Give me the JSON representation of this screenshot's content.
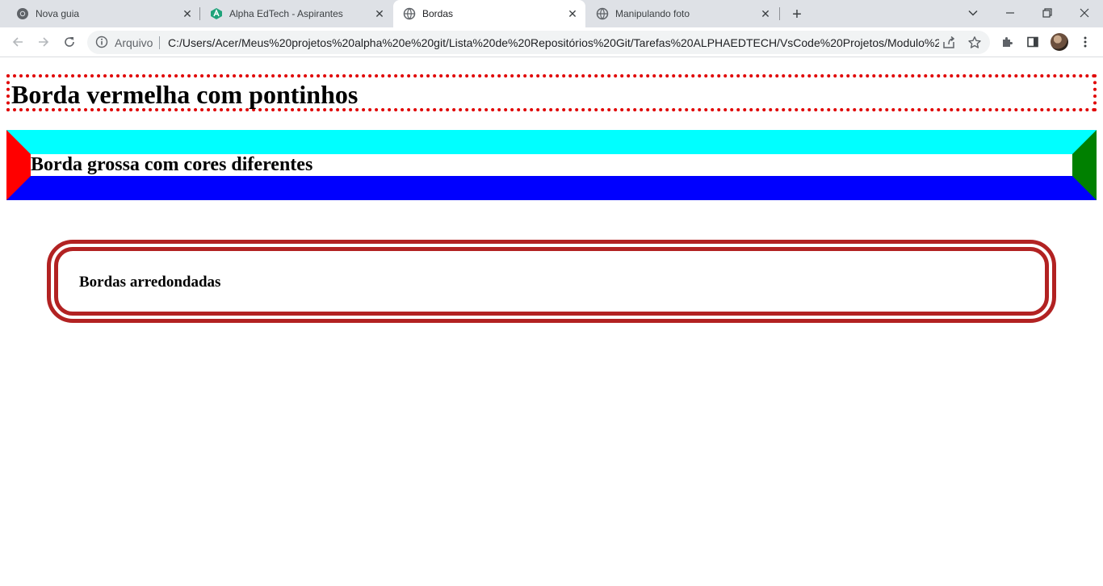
{
  "browser": {
    "tabs": [
      {
        "title": "Nova guia",
        "icon": "chrome-icon",
        "active": false
      },
      {
        "title": "Alpha EdTech - Aspirantes",
        "icon": "alpha-edtech-icon",
        "active": false
      },
      {
        "title": "Bordas",
        "icon": "globe-icon",
        "active": true
      },
      {
        "title": "Manipulando foto",
        "icon": "globe-icon",
        "active": false
      }
    ],
    "address": {
      "chip": "Arquivo",
      "url": "C:/Users/Acer/Meus%20projetos%20alpha%20e%20git/Lista%20de%20Repositórios%20Git/Tarefas%20ALPHAEDTECH/VsCode%20Projetos/Modulo%20..."
    }
  },
  "page": {
    "heading_dotted": "Borda vermelha com pontinhos",
    "heading_thick": "Borda grossa com cores diferentes",
    "heading_rounded": "Bordas arredondadas"
  },
  "colors": {
    "dotted_border": "#e00000",
    "thick_top": "#00ffff",
    "thick_right": "#008000",
    "thick_bottom": "#0000ff",
    "thick_left": "#ff0000",
    "rounded_border": "#b22222"
  }
}
